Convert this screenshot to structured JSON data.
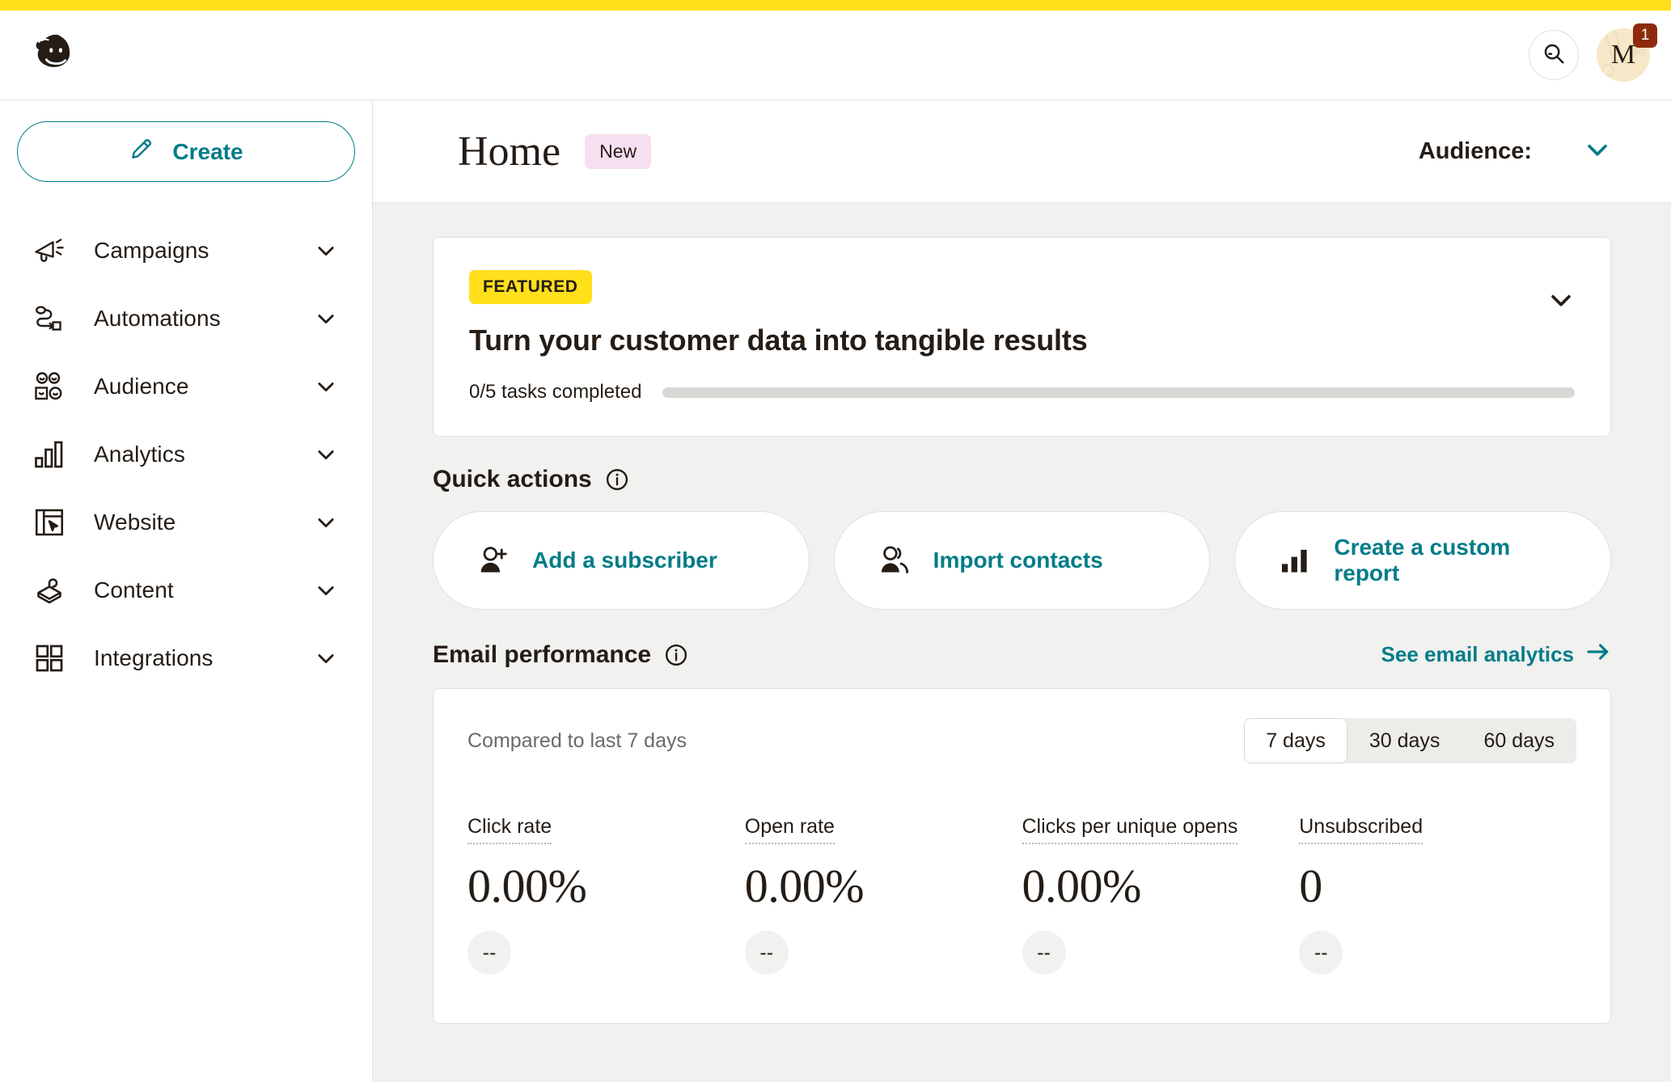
{
  "brand": {
    "logo_icon": "mailchimp-freddie-logo",
    "accent_teal": "#007C89",
    "accent_yellow": "#FFE01B",
    "badge_red": "#8E2B0E",
    "content_bg": "#F1F1EF"
  },
  "header": {
    "search_icon": "search-icon",
    "avatar_letter": "M",
    "avatar_badge_count": "1"
  },
  "sidebar": {
    "create_label": "Create",
    "create_icon": "pencil-icon",
    "items": [
      {
        "label": "Campaigns",
        "icon": "megaphone-icon",
        "chevron": "chevron-down-icon"
      },
      {
        "label": "Automations",
        "icon": "workflow-icon",
        "chevron": "chevron-down-icon"
      },
      {
        "label": "Audience",
        "icon": "people-icon",
        "chevron": "chevron-down-icon"
      },
      {
        "label": "Analytics",
        "icon": "bar-chart-icon",
        "chevron": "chevron-down-icon"
      },
      {
        "label": "Website",
        "icon": "window-cursor-icon",
        "chevron": "chevron-down-icon"
      },
      {
        "label": "Content",
        "icon": "content-icon",
        "chevron": "chevron-down-icon"
      },
      {
        "label": "Integrations",
        "icon": "grid-icon",
        "chevron": "chevron-down-icon"
      }
    ]
  },
  "page": {
    "title": "Home",
    "title_badge": "New",
    "audience_label": "Audience:",
    "audience_chevron": "chevron-down-icon"
  },
  "featured": {
    "badge": "FEATURED",
    "title": "Turn your customer data into tangible results",
    "tasks_text": "0/5 tasks completed",
    "progress_percent": 0,
    "collapse_icon": "chevron-down-icon"
  },
  "quick_actions": {
    "heading": "Quick actions",
    "info_icon": "info-icon",
    "cards": [
      {
        "label": "Add a subscriber",
        "icon": "person-plus-icon"
      },
      {
        "label": "Import contacts",
        "icon": "people-icon"
      },
      {
        "label": "Create a custom report",
        "icon": "bar-chart-icon"
      }
    ]
  },
  "email_performance": {
    "heading": "Email performance",
    "info_icon": "info-icon",
    "link_label": "See email analytics",
    "link_icon": "arrow-right-icon",
    "compare_text": "Compared to last 7 days",
    "range_options": [
      "7 days",
      "30 days",
      "60 days"
    ],
    "range_selected": "7 days",
    "metrics": [
      {
        "label": "Click rate",
        "value": "0.00%",
        "delta": "--"
      },
      {
        "label": "Open rate",
        "value": "0.00%",
        "delta": "--"
      },
      {
        "label": "Clicks per unique opens",
        "value": "0.00%",
        "delta": "--"
      },
      {
        "label": "Unsubscribed",
        "value": "0",
        "delta": "--"
      }
    ]
  }
}
